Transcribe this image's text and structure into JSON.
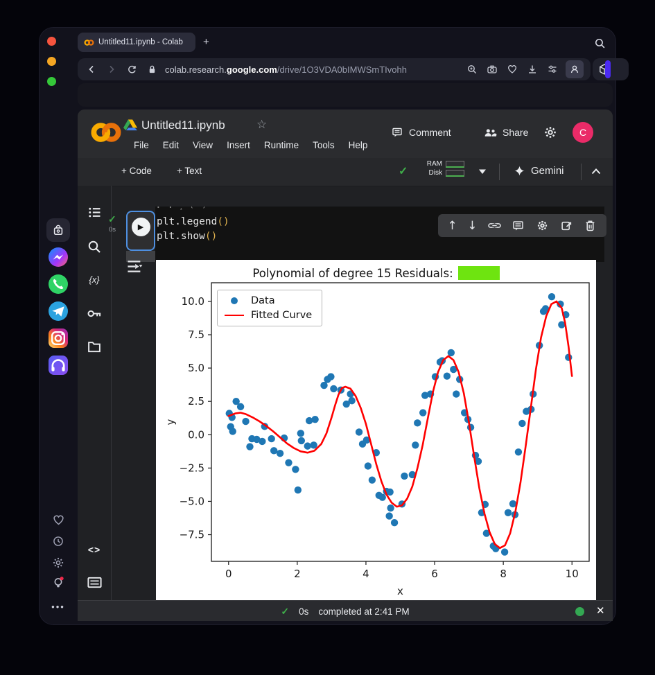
{
  "browser": {
    "tab_title": "Untitled11.ipynb - Colab",
    "new_tab_label": "+",
    "url": {
      "prefix": "colab.research.",
      "bold1": "google",
      "bold2": ".com",
      "path": "/drive/1O3VDA0bIMWSmTIvohh"
    }
  },
  "colab": {
    "header": {
      "title": "Untitled11.ipynb",
      "star": "☆",
      "menus": [
        "File",
        "Edit",
        "View",
        "Insert",
        "Runtime",
        "Tools",
        "Help"
      ],
      "comment_label": "Comment",
      "share_label": "Share",
      "avatar_initial": "C"
    },
    "toolbar": {
      "add_code_label": "+ Code",
      "add_text_label": "+ Text",
      "check": "✓",
      "ram_label": "RAM",
      "disk_label": "Disk",
      "gemini_label": "Gemini"
    },
    "cell": {
      "exec_check": "✓",
      "exec_time": "0s",
      "run_glyph": "▶",
      "code_lines": [
        {
          "body": "plt.legend",
          "paren": "()"
        },
        {
          "body": "plt.show",
          "paren": "()"
        }
      ]
    },
    "sidebar_icon_names": [
      "table-of-contents",
      "search",
      "variables",
      "secrets",
      "files",
      "code-snippets",
      "command-palette",
      "terminal"
    ],
    "variables_glyph": "{x}",
    "snippets_glyph": "<>",
    "status_bar": {
      "check": "✓",
      "exec_time": "0s",
      "message": "completed at 2:41 PM",
      "close": "✕"
    }
  },
  "dock_icon_names": [
    "shopping-bag",
    "messenger",
    "whatsapp",
    "telegram",
    "instagram",
    "headphones",
    "heart",
    "clock",
    "settings",
    "lightbulb",
    "more"
  ],
  "chart_data": {
    "type": "scatter",
    "title": "Polynomial of degree 15 Residuals:",
    "title_highlight_color": "#6ee410",
    "xlabel": "x",
    "ylabel": "y",
    "xlim": [
      -0.5,
      10.5
    ],
    "ylim": [
      -9.5,
      11.4
    ],
    "xticks": [
      0,
      2,
      4,
      6,
      8,
      10
    ],
    "yticks": [
      10.0,
      7.5,
      5.0,
      2.5,
      0.0,
      -2.5,
      -5.0,
      -7.5
    ],
    "grid": false,
    "legend_position": "upper left",
    "legend": [
      {
        "label": "Data",
        "marker": "dot",
        "color": "#1f77b4"
      },
      {
        "label": "Fitted Curve",
        "marker": "line",
        "color": "#ff0000"
      }
    ],
    "series": [
      {
        "name": "Data",
        "type": "scatter",
        "color": "#1f77b4",
        "points": [
          [
            0.02,
            1.6
          ],
          [
            0.1,
            1.3
          ],
          [
            0.06,
            0.6
          ],
          [
            0.12,
            0.25
          ],
          [
            0.22,
            2.5
          ],
          [
            0.35,
            2.1
          ],
          [
            0.5,
            1.0
          ],
          [
            0.62,
            -0.9
          ],
          [
            0.68,
            -0.3
          ],
          [
            0.82,
            -0.35
          ],
          [
            0.98,
            -0.5
          ],
          [
            1.05,
            0.62
          ],
          [
            1.25,
            -0.3
          ],
          [
            1.32,
            -1.2
          ],
          [
            1.5,
            -1.4
          ],
          [
            1.62,
            -0.25
          ],
          [
            1.75,
            -2.1
          ],
          [
            1.95,
            -2.6
          ],
          [
            2.02,
            -4.15
          ],
          [
            2.1,
            0.1
          ],
          [
            2.12,
            -0.45
          ],
          [
            2.3,
            -0.85
          ],
          [
            2.35,
            1.05
          ],
          [
            2.48,
            -0.78
          ],
          [
            2.52,
            1.15
          ],
          [
            2.78,
            3.7
          ],
          [
            2.88,
            4.15
          ],
          [
            2.98,
            4.35
          ],
          [
            3.06,
            3.45
          ],
          [
            3.27,
            3.35
          ],
          [
            3.43,
            2.3
          ],
          [
            3.55,
            3.05
          ],
          [
            3.59,
            2.55
          ],
          [
            3.8,
            0.2
          ],
          [
            3.9,
            -0.7
          ],
          [
            4.02,
            -0.4
          ],
          [
            4.06,
            -2.35
          ],
          [
            4.18,
            -3.4
          ],
          [
            4.3,
            -1.35
          ],
          [
            4.38,
            -4.55
          ],
          [
            4.48,
            -4.7
          ],
          [
            4.6,
            -4.25
          ],
          [
            4.7,
            -4.3
          ],
          [
            4.68,
            -6.1
          ],
          [
            4.72,
            -5.5
          ],
          [
            4.83,
            -6.6
          ],
          [
            5.05,
            -5.2
          ],
          [
            5.12,
            -3.1
          ],
          [
            5.35,
            -3.0
          ],
          [
            5.44,
            -0.78
          ],
          [
            5.5,
            0.88
          ],
          [
            5.66,
            1.65
          ],
          [
            5.72,
            2.95
          ],
          [
            5.88,
            3.05
          ],
          [
            6.02,
            4.35
          ],
          [
            6.16,
            5.45
          ],
          [
            6.22,
            5.55
          ],
          [
            6.36,
            4.4
          ],
          [
            6.48,
            6.15
          ],
          [
            6.55,
            4.9
          ],
          [
            6.63,
            3.05
          ],
          [
            6.73,
            4.15
          ],
          [
            6.87,
            1.65
          ],
          [
            6.97,
            1.15
          ],
          [
            7.05,
            0.55
          ],
          [
            7.19,
            -1.55
          ],
          [
            7.27,
            -2.0
          ],
          [
            7.37,
            -5.85
          ],
          [
            7.47,
            -5.23
          ],
          [
            7.51,
            -7.4
          ],
          [
            7.71,
            -8.35
          ],
          [
            7.78,
            -8.55
          ],
          [
            8.04,
            -8.8
          ],
          [
            8.14,
            -5.85
          ],
          [
            8.28,
            -5.18
          ],
          [
            8.34,
            -6.0
          ],
          [
            8.44,
            -1.3
          ],
          [
            8.55,
            0.85
          ],
          [
            8.67,
            1.75
          ],
          [
            8.81,
            1.9
          ],
          [
            8.87,
            3.05
          ],
          [
            9.05,
            6.7
          ],
          [
            9.17,
            9.25
          ],
          [
            9.23,
            9.45
          ],
          [
            9.41,
            10.35
          ],
          [
            9.66,
            9.8
          ],
          [
            9.7,
            8.25
          ],
          [
            9.82,
            9.0
          ],
          [
            9.9,
            5.8
          ]
        ]
      },
      {
        "name": "Fitted Curve",
        "type": "line",
        "color": "#ff0000",
        "points": [
          [
            0.0,
            1.4
          ],
          [
            0.2,
            1.6
          ],
          [
            0.35,
            1.65
          ],
          [
            0.5,
            1.55
          ],
          [
            0.7,
            1.3
          ],
          [
            0.9,
            1.0
          ],
          [
            1.1,
            0.65
          ],
          [
            1.3,
            0.25
          ],
          [
            1.5,
            -0.2
          ],
          [
            1.7,
            -0.65
          ],
          [
            1.9,
            -1.0
          ],
          [
            2.1,
            -1.25
          ],
          [
            2.3,
            -1.35
          ],
          [
            2.5,
            -1.2
          ],
          [
            2.7,
            -0.7
          ],
          [
            2.85,
            0.1
          ],
          [
            3.0,
            1.3
          ],
          [
            3.1,
            2.2
          ],
          [
            3.2,
            3.0
          ],
          [
            3.3,
            3.5
          ],
          [
            3.4,
            3.6
          ],
          [
            3.55,
            3.45
          ],
          [
            3.7,
            2.9
          ],
          [
            3.85,
            2.0
          ],
          [
            4.0,
            0.8
          ],
          [
            4.15,
            -0.7
          ],
          [
            4.3,
            -2.2
          ],
          [
            4.45,
            -3.5
          ],
          [
            4.6,
            -4.5
          ],
          [
            4.75,
            -5.1
          ],
          [
            4.9,
            -5.4
          ],
          [
            5.05,
            -5.3
          ],
          [
            5.2,
            -4.8
          ],
          [
            5.35,
            -3.9
          ],
          [
            5.5,
            -2.5
          ],
          [
            5.65,
            -0.8
          ],
          [
            5.8,
            1.2
          ],
          [
            5.95,
            3.2
          ],
          [
            6.1,
            4.7
          ],
          [
            6.25,
            5.6
          ],
          [
            6.4,
            5.9
          ],
          [
            6.55,
            5.6
          ],
          [
            6.7,
            4.7
          ],
          [
            6.85,
            3.1
          ],
          [
            7.0,
            0.9
          ],
          [
            7.15,
            -1.6
          ],
          [
            7.3,
            -4.0
          ],
          [
            7.45,
            -5.9
          ],
          [
            7.6,
            -7.3
          ],
          [
            7.75,
            -8.2
          ],
          [
            7.9,
            -8.5
          ],
          [
            8.05,
            -8.3
          ],
          [
            8.2,
            -7.4
          ],
          [
            8.35,
            -5.8
          ],
          [
            8.5,
            -3.6
          ],
          [
            8.65,
            -0.9
          ],
          [
            8.8,
            2.0
          ],
          [
            8.95,
            4.9
          ],
          [
            9.1,
            7.3
          ],
          [
            9.25,
            8.9
          ],
          [
            9.4,
            9.8
          ],
          [
            9.55,
            10.0
          ],
          [
            9.7,
            9.5
          ],
          [
            9.8,
            8.4
          ],
          [
            9.9,
            6.6
          ],
          [
            10.0,
            4.4
          ]
        ]
      }
    ]
  }
}
